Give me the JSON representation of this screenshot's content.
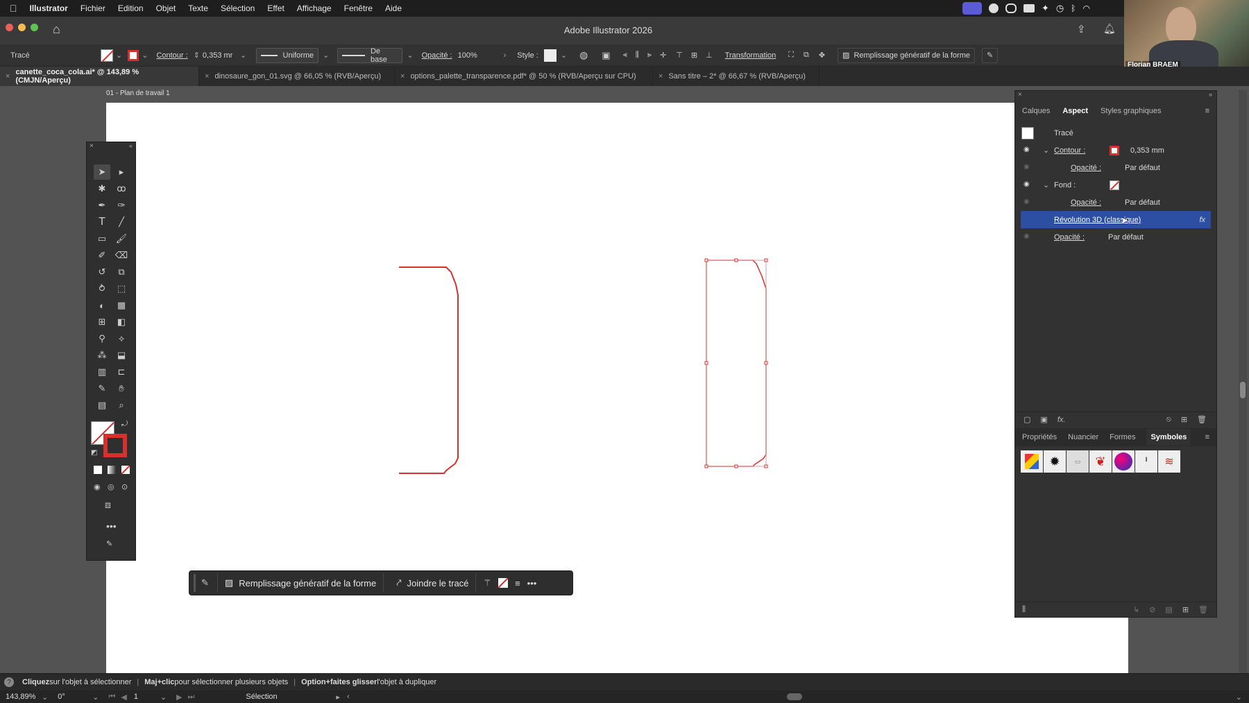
{
  "menubar": {
    "app": "Illustrator",
    "items": [
      "Fichier",
      "Edition",
      "Objet",
      "Texte",
      "Sélection",
      "Effet",
      "Affichage",
      "Fenêtre",
      "Aide"
    ]
  },
  "window": {
    "title": "Adobe Illustrator 2026"
  },
  "controlbar": {
    "object_type": "Tracé",
    "contour_label": "Contour :",
    "stroke_weight": "0,353 mr",
    "profile": "Uniforme",
    "brush": "De base",
    "opacity_label": "Opacité :",
    "opacity_value": "100%",
    "style_label": "Style :",
    "transform_label": "Transformation",
    "gen_fill": "Remplissage génératif de la forme"
  },
  "tabs": [
    {
      "label": "canette_coca_cola.ai* @ 143,89 % (CMJN/Aperçu)",
      "active": true
    },
    {
      "label": "dinosaure_gon_01.svg @ 66,05 % (RVB/Aperçu)",
      "active": false
    },
    {
      "label": "options_palette_transparence.pdf* @ 50 % (RVB/Aperçu sur CPU)",
      "active": false
    },
    {
      "label": "Sans titre – 2* @ 66,67 % (RVB/Aperçu)",
      "active": false
    }
  ],
  "artboard": {
    "label": "01 - Plan de travail 1"
  },
  "contextbar": {
    "gen_fill": "Remplissage génératif de la forme",
    "join": "Joindre le tracé"
  },
  "panel": {
    "tabs": [
      "Calques",
      "Aspect",
      "Styles graphiques"
    ],
    "active_tab": "Aspect",
    "object": "Tracé",
    "contour_label": "Contour :",
    "contour_value": "0,353 mm",
    "opacity_label": "Opacité :",
    "default": "Par défaut",
    "fond_label": "Fond :",
    "effect": "Révolution 3D (classique)",
    "fx": "fx",
    "bottom_tabs": [
      "Propriétés",
      "Nuancier",
      "Formes",
      "Symboles"
    ],
    "bottom_active": "Symboles"
  },
  "status": {
    "hint1a": "Cliquez",
    "hint1b": " sur l'objet à sélectionner",
    "hint2a": "Maj+clic",
    "hint2b": " pour sélectionner plusieurs objets",
    "hint3a": "Option+faites glisser",
    "hint3b": " l'objet à dupliquer",
    "zoom": "143,89%",
    "angle": "0°",
    "page": "1",
    "tool": "Sélection"
  },
  "webcam": {
    "name": "Florian BRAEM"
  },
  "colors": {
    "accent": "#3b5bd6",
    "stroke": "#d8302c",
    "selected_row": "#2c4fa3"
  }
}
